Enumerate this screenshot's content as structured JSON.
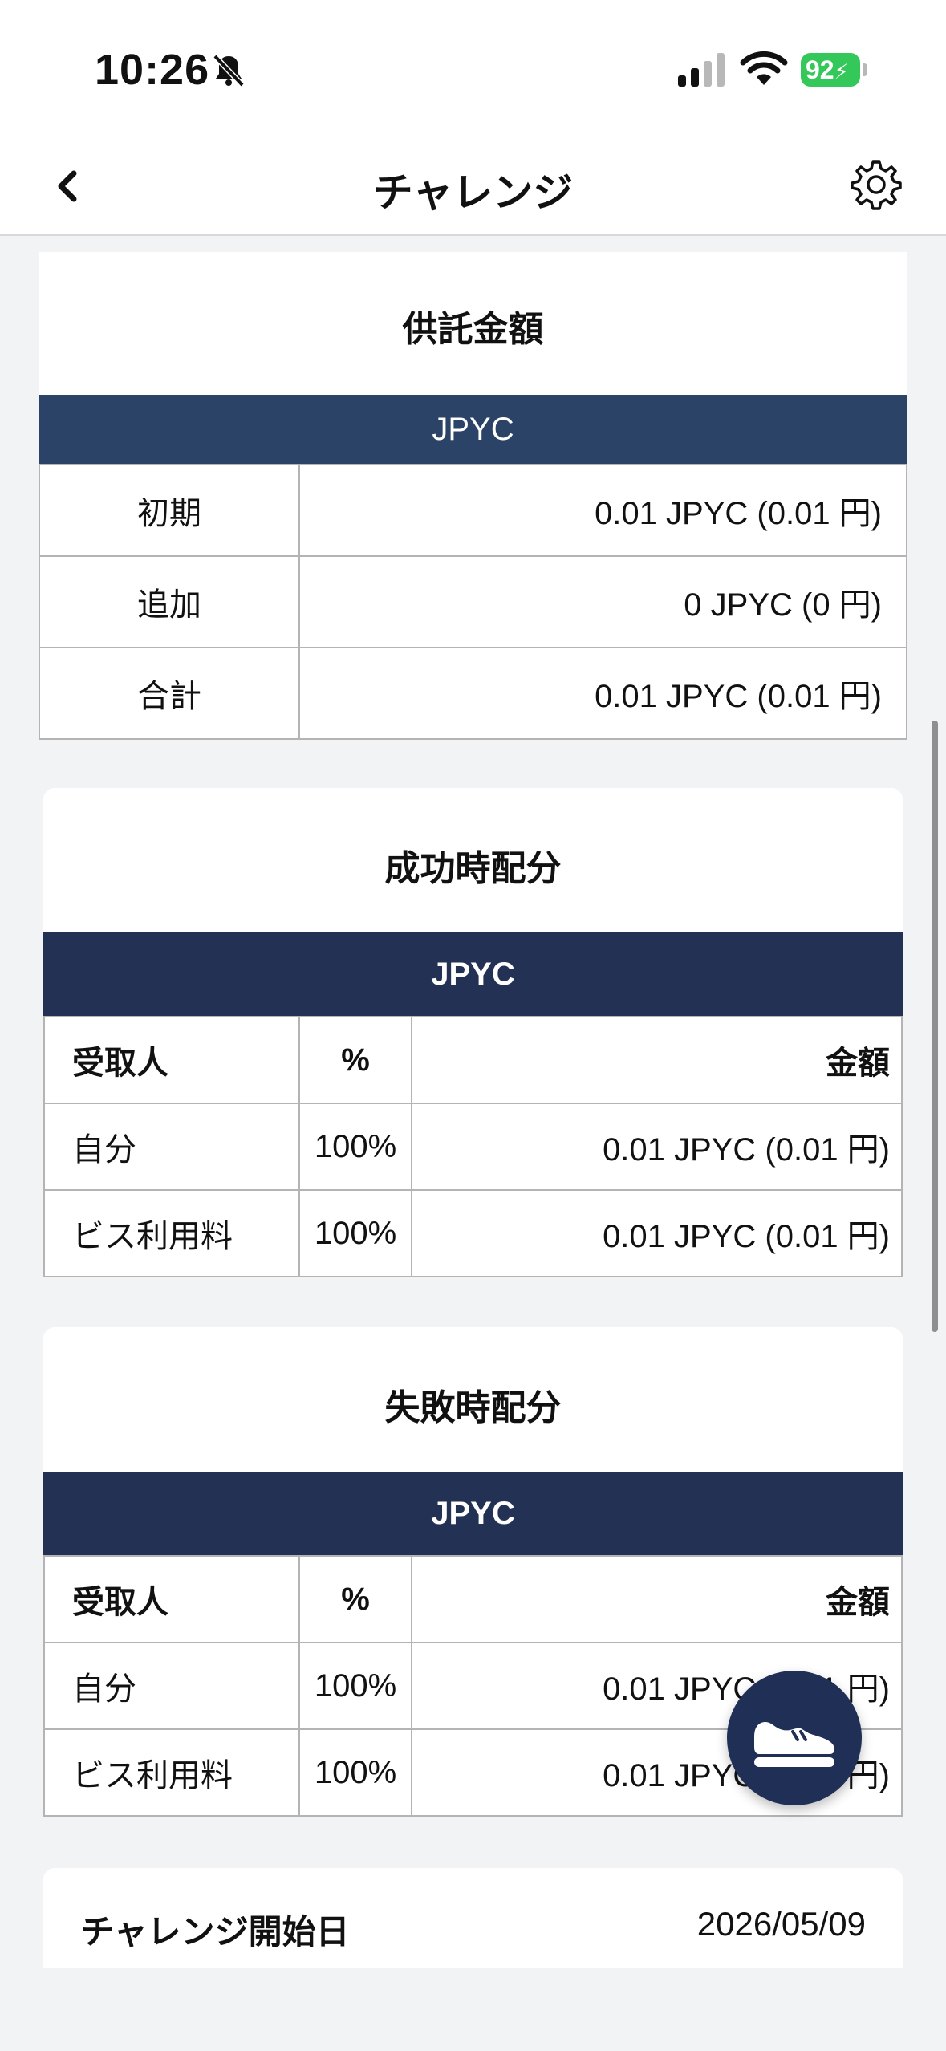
{
  "status_bar": {
    "time": "10:26",
    "battery": "92"
  },
  "nav": {
    "title": "チャレンジ"
  },
  "deposit": {
    "title": "供託金額",
    "currency": "JPYC",
    "rows": [
      {
        "label": "初期",
        "value": "0.01 JPYC (0.01 円)"
      },
      {
        "label": "追加",
        "value": "0 JPYC (0 円)"
      },
      {
        "label": "合計",
        "value": "0.01 JPYC (0.01 円)"
      }
    ]
  },
  "success": {
    "title": "成功時配分",
    "currency": "JPYC",
    "headers": {
      "recipient": "受取人",
      "percent": "%",
      "amount": "金額"
    },
    "rows": [
      {
        "recipient": "自分",
        "percent": "100%",
        "amount": "0.01 JPYC (0.01 円)"
      },
      {
        "recipient": "ビス利用料",
        "percent": "100%",
        "amount": "0.01 JPYC (0.01 円)"
      }
    ]
  },
  "failure": {
    "title": "失敗時配分",
    "currency": "JPYC",
    "headers": {
      "recipient": "受取人",
      "percent": "%",
      "amount": "金額"
    },
    "rows": [
      {
        "recipient": "自分",
        "percent": "100%",
        "amount": "0.01 JPYC (0.01 円)"
      },
      {
        "recipient": "ビス利用料",
        "percent": "100%",
        "amount": "0.01 JPYC (0.01 円)"
      }
    ]
  },
  "start_date": {
    "label": "チャレンジ開始日",
    "value": "2026/05/09"
  },
  "colors": {
    "band_deposit": "#2b4367",
    "band_distribution": "#223154",
    "fab": "#1f2f55",
    "battery": "#34c759"
  },
  "icons": {
    "back": "chevron-left-icon",
    "settings": "gear-icon",
    "fab": "sneaker-icon"
  }
}
